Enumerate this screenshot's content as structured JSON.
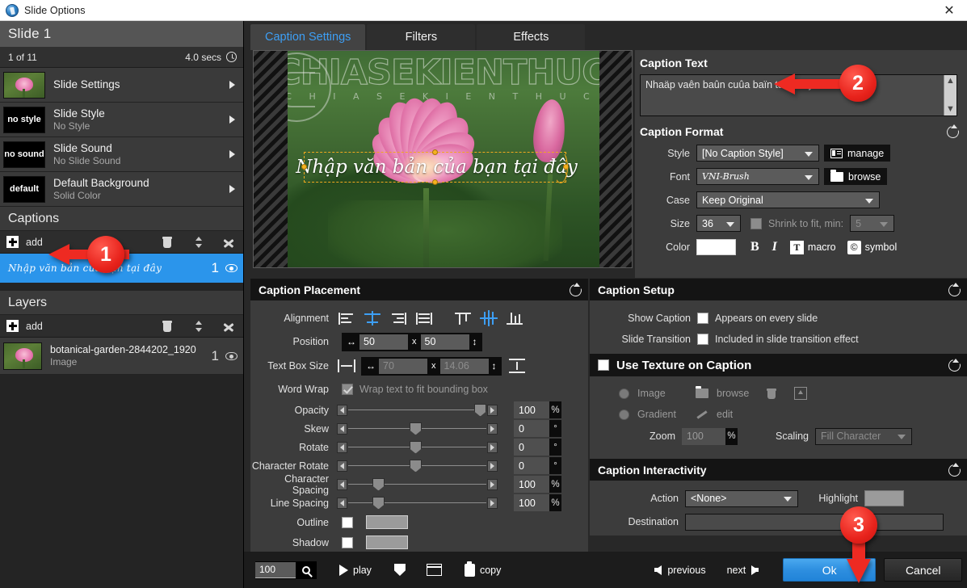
{
  "window": {
    "title": "Slide Options",
    "close_label": "✕",
    "app_icon": "app-icon"
  },
  "sidebar": {
    "slide_title": "Slide 1",
    "slide_index": "1 of 11",
    "duration": "4.0 secs",
    "properties": [
      {
        "thumb": "photo",
        "title": "Slide Settings",
        "sub": ""
      },
      {
        "thumb": "no style",
        "title": "Slide Style",
        "sub": "No Style"
      },
      {
        "thumb": "no sound",
        "title": "Slide Sound",
        "sub": "No Slide Sound"
      },
      {
        "thumb": "default",
        "title": "Default Background",
        "sub": "Solid Color"
      }
    ],
    "captions": {
      "header": "Captions",
      "add_label": "add",
      "items": [
        {
          "text": "Nhập văn bản của bạn tại đây",
          "count": "1"
        }
      ]
    },
    "layers": {
      "header": "Layers",
      "add_label": "add",
      "items": [
        {
          "title": "botanical-garden-2844202_1920",
          "sub": "Image",
          "count": "1"
        }
      ]
    }
  },
  "tabs": [
    {
      "label": "Caption Settings",
      "active": true
    },
    {
      "label": "Filters",
      "active": false
    },
    {
      "label": "Effects",
      "active": false
    }
  ],
  "preview": {
    "watermark": "CHIASEKIENTHUC",
    "watermark_sub": "C H I A S E K I E N T H U C",
    "caption_overlay": "Nhập văn bản của bạn tại đây"
  },
  "caption_text": {
    "header": "Caption Text",
    "value": "Nhaäp vaên baûn cuûa baïn taïi ñaây"
  },
  "caption_format": {
    "header": "Caption Format",
    "style_label": "Style",
    "style_value": "[No Caption Style]",
    "manage_label": "manage",
    "font_label": "Font",
    "font_value": "VNI-Brush",
    "browse_label": "browse",
    "case_label": "Case",
    "case_value": "Keep Original",
    "size_label": "Size",
    "size_value": "36",
    "shrink_label": "Shrink to fit, min:",
    "shrink_min": "5",
    "color_label": "Color",
    "color_value": "#ffffff",
    "bold_label": "B",
    "italic_label": "I",
    "macro_label": "macro",
    "macro_icon_label": "T",
    "symbol_label": "symbol",
    "symbol_icon_label": "©"
  },
  "caption_placement": {
    "header": "Caption Placement",
    "alignment_label": "Alignment",
    "alignment_h": "center",
    "alignment_v": "middle",
    "position_label": "Position",
    "position_x": "50",
    "position_y": "50",
    "textbox_label": "Text Box Size",
    "textbox_w": "70",
    "textbox_h": "14.06",
    "wordwrap_label": "Word Wrap",
    "wordwrap_text": "Wrap text to fit bounding box",
    "wordwrap_checked": true,
    "sliders": [
      {
        "label": "Opacity",
        "value": "100",
        "unit": "%",
        "pos": 100
      },
      {
        "label": "Skew",
        "value": "0",
        "unit": "°",
        "pos": 50
      },
      {
        "label": "Rotate",
        "value": "0",
        "unit": "°",
        "pos": 50
      },
      {
        "label": "Character Rotate",
        "value": "0",
        "unit": "°",
        "pos": 50
      },
      {
        "label": "Character Spacing",
        "value": "100",
        "unit": "%",
        "pos": 24
      },
      {
        "label": "Line Spacing",
        "value": "100",
        "unit": "%",
        "pos": 24
      }
    ],
    "outline_label": "Outline",
    "outline_checked": false,
    "outline_color": "#9b9b9b",
    "shadow_label": "Shadow",
    "shadow_checked": false,
    "shadow_color": "#9b9b9b"
  },
  "caption_setup": {
    "header": "Caption Setup",
    "show_caption_label": "Show Caption",
    "show_caption_text": "Appears on every slide",
    "show_caption_checked": false,
    "transition_label": "Slide Transition",
    "transition_text": "Included in slide transition effect",
    "transition_checked": false
  },
  "texture": {
    "header": "Use Texture on Caption",
    "enabled": false,
    "image_label": "Image",
    "browse_label": "browse",
    "gradient_label": "Gradient",
    "edit_label": "edit",
    "zoom_label": "Zoom",
    "zoom_value": "100",
    "zoom_unit": "%",
    "scaling_label": "Scaling",
    "scaling_value": "Fill Character"
  },
  "interactivity": {
    "header": "Caption Interactivity",
    "action_label": "Action",
    "action_value": "<None>",
    "highlight_label": "Highlight",
    "highlight_color": "#9b9b9b",
    "destination_label": "Destination",
    "destination_value": ""
  },
  "bottombar": {
    "zoom_value": "100",
    "play_label": "play",
    "copy_label": "copy",
    "previous_label": "previous",
    "next_label": "next",
    "ok_label": "Ok",
    "cancel_label": "Cancel"
  },
  "annotations": [
    {
      "number": "1"
    },
    {
      "number": "2"
    },
    {
      "number": "3"
    }
  ],
  "colors": {
    "accent": "#3d9ff5",
    "selection": "#2b95eb",
    "annotation": "#e8231c"
  }
}
